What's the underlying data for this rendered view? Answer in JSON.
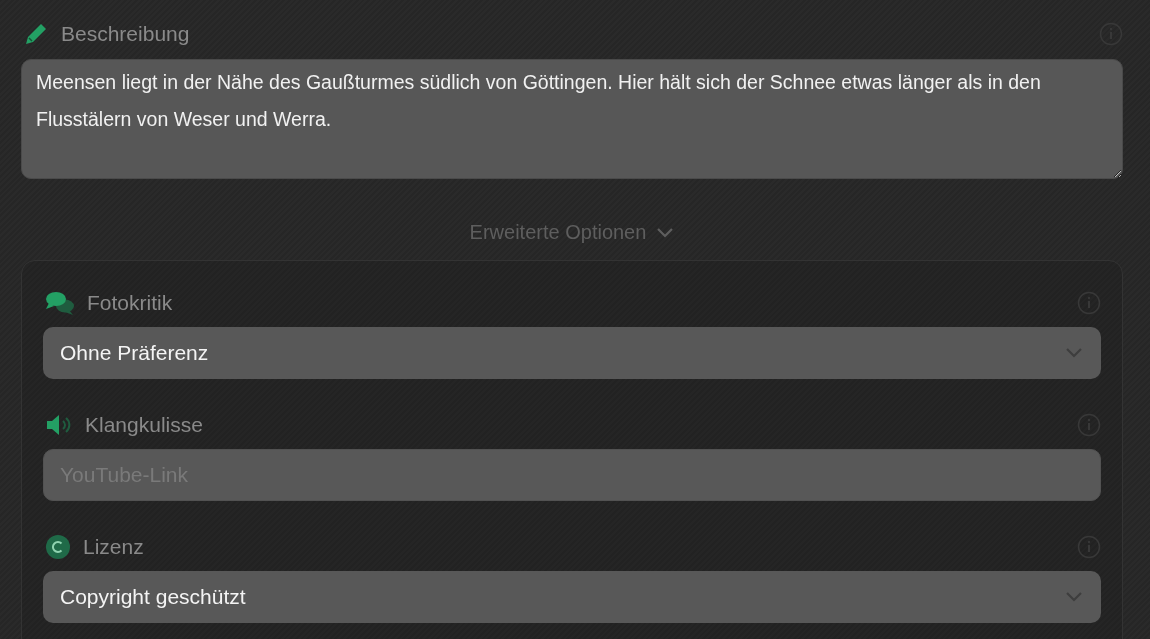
{
  "description": {
    "label": "Beschreibung",
    "value": "Meensen liegt in der Nähe des Gaußturmes südlich von Göttingen. Hier hält sich der Schnee etwas länger als in den Flusstälern von Weser und Werra."
  },
  "advanced_toggle": {
    "label": "Erweiterte Optionen",
    "expanded": false
  },
  "fields": [
    {
      "kind": "select",
      "label": "Fotokritik",
      "value": "Ohne Präferenz"
    },
    {
      "kind": "input",
      "label": "Klangkulisse",
      "placeholder": "YouTube-Link"
    },
    {
      "kind": "select",
      "label": "Lizenz",
      "value": "Copyright geschützt"
    }
  ]
}
